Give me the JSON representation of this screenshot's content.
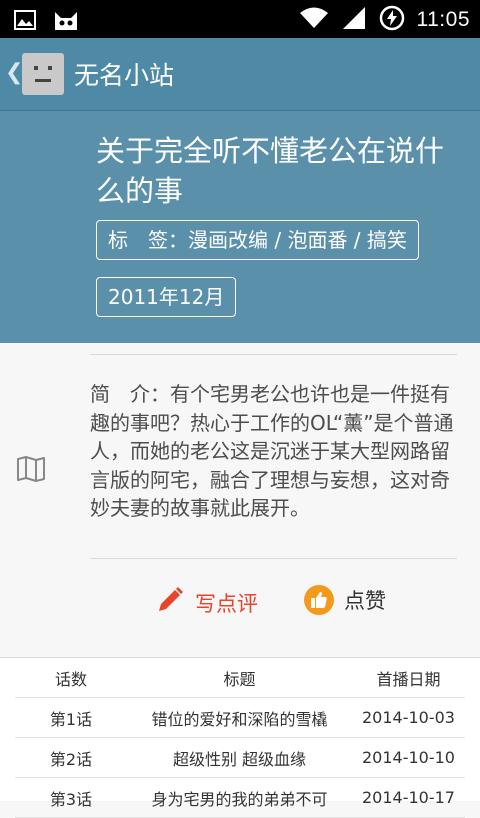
{
  "statusbar": {
    "time": "11:05"
  },
  "appbar": {
    "site_name": "无名小站"
  },
  "detail": {
    "title": "关于完全听不懂老公在说什么的事",
    "tags": "标　签：漫画改编 / 泡面番 / 搞笑",
    "date": "2011年12月",
    "intro": "简　介：有个宅男老公也许也是一件挺有趣的事吧？热心于工作的OL“薰”是个普通人，而她的老公这是沉迷于某大型网路留言版的阿宅，融合了理想与妄想，这对奇妙夫妻的故事就此展开。"
  },
  "actions": {
    "review_label": "写点评",
    "like_label": "点赞"
  },
  "colors": {
    "appbar": "#4e8aa5",
    "header": "#5b90aa",
    "review": "#e8442b",
    "like": "#f39a1d"
  },
  "episodes": {
    "headers": [
      "话数",
      "标题",
      "首播日期"
    ],
    "rows": [
      [
        "第1话",
        "错位的爱好和深陷的雪橇",
        "2014-10-03"
      ],
      [
        "第2话",
        "超级性别 超级血缘",
        "2014-10-10"
      ],
      [
        "第3话",
        "身为宅男的我的弟弟不可",
        "2014-10-17"
      ]
    ]
  }
}
